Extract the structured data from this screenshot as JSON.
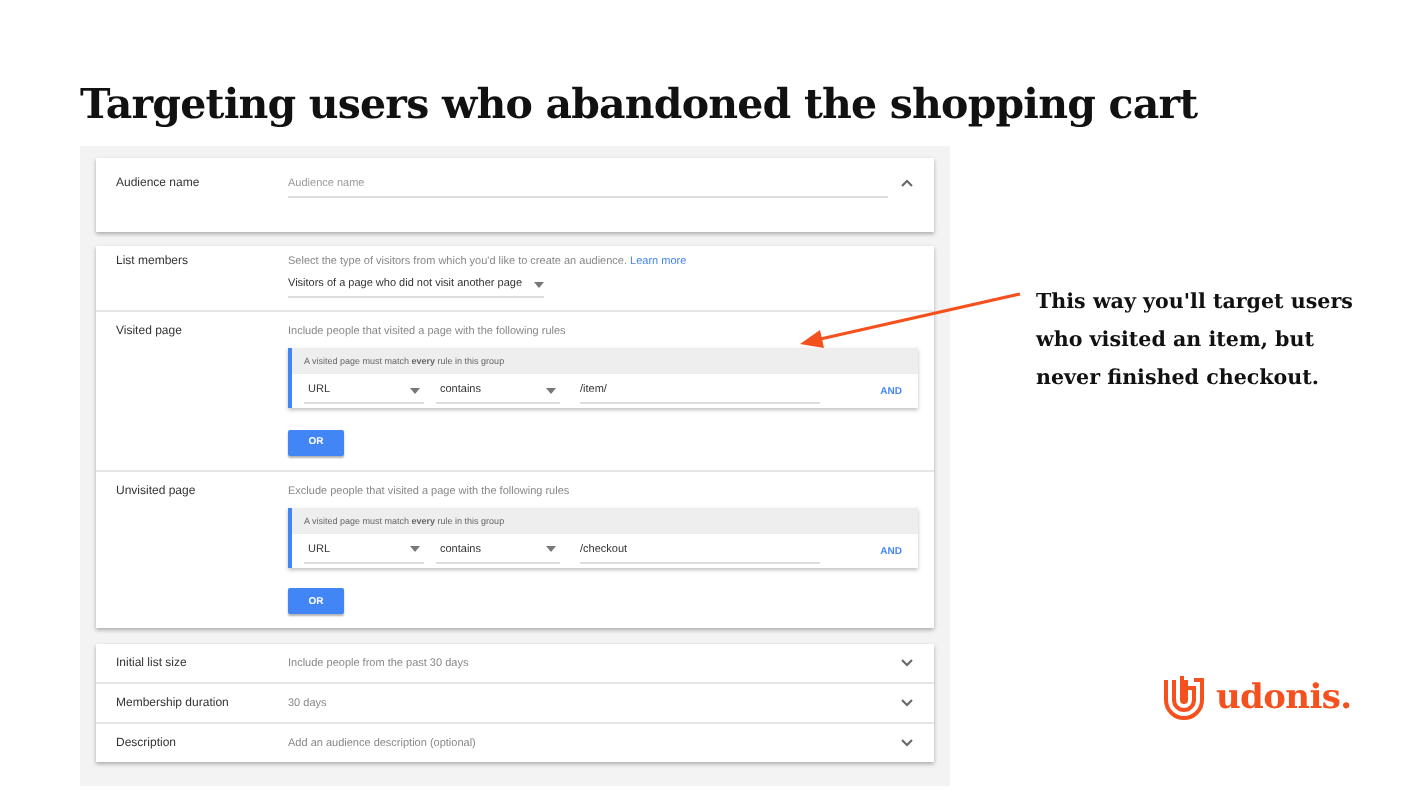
{
  "title": "Targeting users who abandoned the shopping cart",
  "audience_name": {
    "label": "Audience name",
    "placeholder": "Audience name",
    "expanded": true
  },
  "list_members": {
    "label": "List members",
    "hint": "Select the type of visitors from which you'd like to create an audience.",
    "link": "Learn more",
    "dropdown": "Visitors of a page who did not visit another page"
  },
  "rule_sections": [
    {
      "label": "Visited page",
      "hint": "Include people that visited a page with the following rules",
      "group_note": "A visited page must match **every** rule in this group",
      "rules": [
        {
          "field": "URL",
          "operator": "contains",
          "value": "/item/",
          "and_button": "AND"
        }
      ],
      "or_button": "OR"
    },
    {
      "label": "Unvisited page",
      "hint": "Exclude people that visited a page with the following rules",
      "group_note": "A visited page must match **every** rule in this group",
      "rules": [
        {
          "field": "URL",
          "operator": "contains",
          "value": "/checkout",
          "and_button": "AND"
        }
      ],
      "or_button": "OR"
    }
  ],
  "settings": [
    {
      "label": "Initial list size",
      "value": "Include people from the past 30 days",
      "expanded": false
    },
    {
      "label": "Membership duration",
      "value": "30 days",
      "expanded": false
    },
    {
      "label": "Description",
      "value": "Add an audience description (optional)",
      "expanded": false
    }
  ],
  "annotation": "This way you'll target users who visited an item, but never finished checkout.",
  "logo": {
    "text": "udonis."
  }
}
